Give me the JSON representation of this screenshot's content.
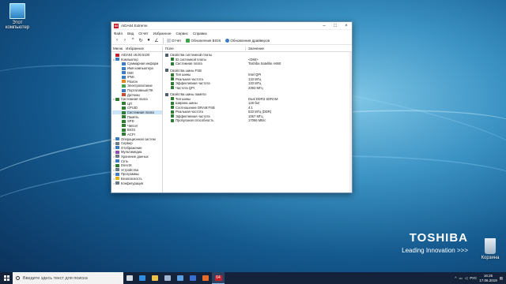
{
  "desktop": {
    "icons": [
      {
        "label": "Этот компьютер"
      },
      {
        "label": "Корзина"
      }
    ],
    "brand": {
      "logo": "TOSHIBA",
      "tagline": "Leading Innovation >>>"
    }
  },
  "window": {
    "app_icon": "64",
    "title": "AIDA64 Extreme",
    "menu": [
      "Файл",
      "Вид",
      "Отчёт",
      "Избранное",
      "Сервис",
      "Справка"
    ],
    "toolbar": {
      "report_label": "Отчёт",
      "bios_update_label": "Обновления BIOS",
      "driver_update_label": "Обновления драйверов"
    },
    "left_tabs": [
      "Меню",
      "Избранное"
    ],
    "tree": [
      {
        "label": "AIDA64 v6.00.5100",
        "exp": "",
        "color": "#c21f2c",
        "indent": 0
      },
      {
        "label": "Компьютер",
        "exp": "v",
        "color": "#3b7cc5",
        "indent": 0
      },
      {
        "label": "Суммарная информ",
        "exp": "",
        "color": "#3b7cc5",
        "indent": 2
      },
      {
        "label": "Имя компьютера",
        "exp": "",
        "color": "#3b7cc5",
        "indent": 2
      },
      {
        "label": "DMI",
        "exp": "",
        "color": "#3b7cc5",
        "indent": 2
      },
      {
        "label": "IPMI",
        "exp": "",
        "color": "#3b7cc5",
        "indent": 2
      },
      {
        "label": "Разгон",
        "exp": "",
        "color": "#e08a1e",
        "indent": 2
      },
      {
        "label": "Электропитание",
        "exp": "",
        "color": "#3fa34d",
        "indent": 2
      },
      {
        "label": "Портативный ПК",
        "exp": "",
        "color": "#3b7cc5",
        "indent": 2
      },
      {
        "label": "Датчики",
        "exp": "",
        "color": "#c24b2b",
        "indent": 2
      },
      {
        "label": "Системная плата",
        "exp": "v",
        "color": "#2f7d32",
        "indent": 0
      },
      {
        "label": "ЦП",
        "exp": "",
        "color": "#2f7d32",
        "indent": 2
      },
      {
        "label": "CPUID",
        "exp": "",
        "color": "#2f7d32",
        "indent": 2
      },
      {
        "label": "Системная плата",
        "exp": "",
        "color": "#2f7d32",
        "indent": 2,
        "selected": true
      },
      {
        "label": "Память",
        "exp": "",
        "color": "#2f7d32",
        "indent": 2
      },
      {
        "label": "SPD",
        "exp": "",
        "color": "#2f7d32",
        "indent": 2
      },
      {
        "label": "Чипсет",
        "exp": "",
        "color": "#2f7d32",
        "indent": 2
      },
      {
        "label": "BIOS",
        "exp": "",
        "color": "#2f7d32",
        "indent": 2
      },
      {
        "label": "ACPI",
        "exp": "",
        "color": "#2f7d32",
        "indent": 2
      },
      {
        "label": "Операционная систем",
        "exp": ">",
        "color": "#3b7cc5",
        "indent": 0
      },
      {
        "label": "Сервер",
        "exp": ">",
        "color": "#6c7a89",
        "indent": 0
      },
      {
        "label": "Отображение",
        "exp": ">",
        "color": "#3b7cc5",
        "indent": 0
      },
      {
        "label": "Мультимедиа",
        "exp": ">",
        "color": "#8a4fb0",
        "indent": 0
      },
      {
        "label": "Хранение данных",
        "exp": ">",
        "color": "#6c7a89",
        "indent": 0
      },
      {
        "label": "Сеть",
        "exp": ">",
        "color": "#3b7cc5",
        "indent": 0
      },
      {
        "label": "DirectX",
        "exp": ">",
        "color": "#2f7d32",
        "indent": 0
      },
      {
        "label": "Устройства",
        "exp": ">",
        "color": "#6c7a89",
        "indent": 0
      },
      {
        "label": "Программы",
        "exp": ">",
        "color": "#3b7cc5",
        "indent": 0
      },
      {
        "label": "Безопасность",
        "exp": ">",
        "color": "#e0b21e",
        "indent": 0
      },
      {
        "label": "Конфигурация",
        "exp": ">",
        "color": "#6c7a89",
        "indent": 0
      }
    ],
    "columns": {
      "field": "Поле",
      "value": "Значение"
    },
    "rows": [
      {
        "type": "section",
        "field": "Свойства системной платы",
        "value": ""
      },
      {
        "type": "item",
        "field": "ID системной платы",
        "value": "<DMI>"
      },
      {
        "type": "item",
        "field": "Системная плата",
        "value": "Toshiba Satellite A660"
      },
      {
        "type": "gap"
      },
      {
        "type": "section",
        "field": "Свойства шины FSB",
        "value": ""
      },
      {
        "type": "item",
        "field": "Тип шины",
        "value": "Intel QPI"
      },
      {
        "type": "item",
        "field": "Реальная частота",
        "value": "133 МГц"
      },
      {
        "type": "item",
        "field": "Эффективная частота",
        "value": "133 МГц"
      },
      {
        "type": "item",
        "field": "Частота QPI",
        "value": "2393 МГц"
      },
      {
        "type": "gap"
      },
      {
        "type": "section",
        "field": "Свойства шины памяти",
        "value": ""
      },
      {
        "type": "item",
        "field": "Тип шины",
        "value": "Dual DDR3 SDRAM"
      },
      {
        "type": "item",
        "field": "Ширина шины",
        "value": "128 бит"
      },
      {
        "type": "item",
        "field": "Соотношение DRAM:FSB",
        "value": "4:1"
      },
      {
        "type": "item",
        "field": "Реальная частота",
        "value": "533 МГц (DDR)"
      },
      {
        "type": "item",
        "field": "Эффективная частота",
        "value": "1067 МГц"
      },
      {
        "type": "item",
        "field": "Пропускная способность",
        "value": "17066 МБ/с"
      }
    ]
  },
  "taskbar": {
    "search_placeholder": "Введите здесь текст для поиска",
    "apps": [
      {
        "name": "task-view",
        "color": "#d0d8e0"
      },
      {
        "name": "edge",
        "color": "#2f8ee0"
      },
      {
        "name": "explorer",
        "color": "#e8c04a"
      },
      {
        "name": "store",
        "color": "#9fb6d0"
      },
      {
        "name": "mail",
        "color": "#5aa0e0"
      },
      {
        "name": "media",
        "color": "#3a6fd0"
      },
      {
        "name": "firefox",
        "color": "#e46b2a"
      },
      {
        "name": "aida64",
        "color": "#c21f2c",
        "label": "64",
        "active": true
      }
    ],
    "lang": "РУС",
    "time": "16:25",
    "date": "17.06.2019"
  }
}
